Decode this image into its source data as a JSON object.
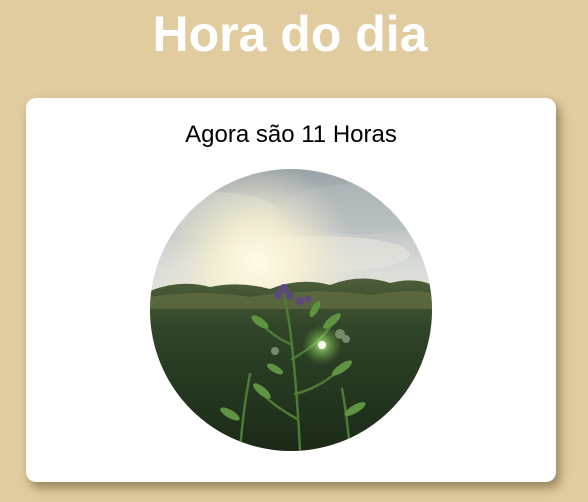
{
  "page": {
    "title": "Hora do dia",
    "background_color": "#e0cc9e"
  },
  "card": {
    "time_message": "Agora são 11 Horas",
    "image": {
      "icon": "morning-meadow-photo",
      "subject": "plant in a green field with sunlight"
    }
  }
}
